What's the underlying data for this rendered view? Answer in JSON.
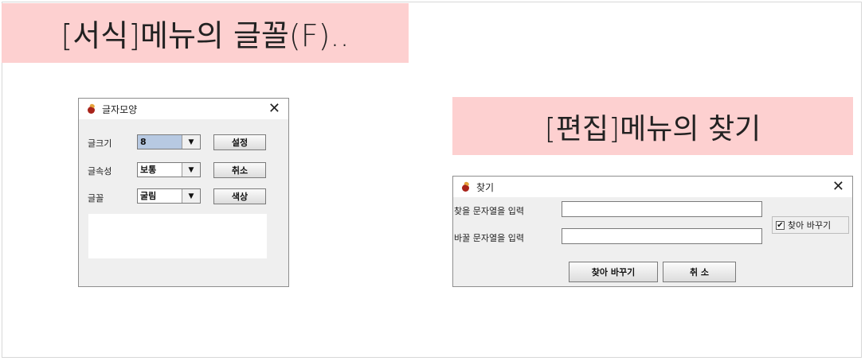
{
  "banners": {
    "format_menu": "[서식]메뉴의 글꼴(F)..",
    "edit_menu": "[편집]메뉴의 찾기"
  },
  "font_dialog": {
    "title": "글자모양",
    "close_glyph": "✕",
    "size_label": "글크기",
    "size_value": "8",
    "style_label": "글속성",
    "style_value": "보통",
    "font_label": "글꼴",
    "font_value": "굴림",
    "arrow_glyph": "▼",
    "set_button": "설정",
    "cancel_button": "취소",
    "color_button": "색상"
  },
  "find_dialog": {
    "title": "찾기",
    "close_glyph": "✕",
    "find_label": "찾을 문자열을 입력",
    "find_value": "",
    "replace_label": "바꿀 문자열을 입력",
    "replace_value": "",
    "replace_checkbox_label": "찾아 바꾸기",
    "replace_checkbox_checked": true,
    "check_glyph": "✔",
    "ok_button": "찾아 바꾸기",
    "cancel_button": "취 소"
  },
  "colors": {
    "banner_bg": "#fdd0d0",
    "dialog_bg": "#efefef",
    "selection": "#b7c9e2"
  }
}
